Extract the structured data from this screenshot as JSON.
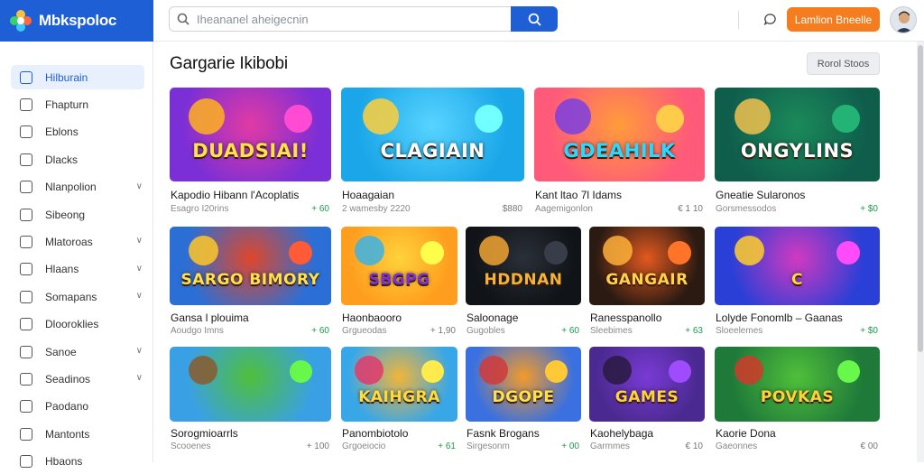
{
  "header": {
    "brand_name": "Mbkspoloc",
    "search_placeholder": "Iheananel aheigecnin",
    "cta_label": "Lamlion Bneelle"
  },
  "sidebar": {
    "items": [
      {
        "label": "Hilburain",
        "active": true,
        "chevron": false
      },
      {
        "label": "Fhapturn",
        "active": false,
        "chevron": false
      },
      {
        "label": "Eblons",
        "active": false,
        "chevron": false
      },
      {
        "label": "Dlacks",
        "active": false,
        "chevron": false
      },
      {
        "label": "Nlanpolion",
        "active": false,
        "chevron": true
      },
      {
        "label": "Sibeong",
        "active": false,
        "chevron": false
      },
      {
        "label": "Mlatoroas",
        "active": false,
        "chevron": true
      },
      {
        "label": "Hlaans",
        "active": false,
        "chevron": true
      },
      {
        "label": "Somapans",
        "active": false,
        "chevron": true
      },
      {
        "label": "Dlooroklies",
        "active": false,
        "chevron": false
      },
      {
        "label": "Sanoe",
        "active": false,
        "chevron": true
      },
      {
        "label": "Seadinos",
        "active": false,
        "chevron": true
      },
      {
        "label": "Paodano",
        "active": false,
        "chevron": false
      },
      {
        "label": "Mantonts",
        "active": false,
        "chevron": false
      },
      {
        "label": "Hbaons",
        "active": false,
        "chevron": false
      }
    ]
  },
  "main": {
    "title": "Gargarie Ikibobi",
    "sort_label": "Rorol Stoos"
  },
  "games": [
    {
      "title": "Kapodio Hibann l'Acoplatis",
      "sub": "Esagro I20rins",
      "price": "+ 60",
      "green": true,
      "art": "DUADSIAI!",
      "badge": "",
      "colors": [
        "#7b2fd6",
        "#e23aa3",
        "#ffb21e"
      ],
      "word_color": "#ffe14a"
    },
    {
      "title": "Hoaagaian",
      "sub": "2 wamesby 2220",
      "price": "$880",
      "green": false,
      "art": "CLAGIAIN",
      "badge": "",
      "colors": [
        "#1aa6e8",
        "#58d4ff",
        "#ffcf3a"
      ],
      "word_color": "#ffffff"
    },
    {
      "title": "Kant ltao 7l Idams",
      "sub": "Aagemigonlon",
      "price": "€ 1 10",
      "green": false,
      "art": "GDEAHILK",
      "badge": "",
      "colors": [
        "#ff5a7a",
        "#ff9c3a",
        "#7b3fe0"
      ],
      "word_color": "#2ad9ff"
    },
    {
      "title": "Gneatie Sularonos",
      "sub": "Gorsmessodos",
      "price": "+ $0",
      "green": true,
      "art": "ONGYLINS",
      "badge": "",
      "colors": [
        "#0f5e4c",
        "#1b8a5a",
        "#f2c14e"
      ],
      "word_color": "#ffffff"
    },
    {
      "title": "Gansa l plouima",
      "sub": "Aoudgo Imns",
      "price": "+ 60",
      "green": true,
      "art": "SARGO BIMORY",
      "badge": "",
      "colors": [
        "#2b6fd6",
        "#e0462a",
        "#ffc728"
      ],
      "word_color": "#ffe14a"
    },
    {
      "title": "Haonbaooro",
      "sub": "Grgueodas",
      "price": "+ 1,90",
      "green": false,
      "art": "SBGPG",
      "badge": "",
      "colors": [
        "#ff9d1e",
        "#ffd23a",
        "#3bb3e6"
      ],
      "word_color": "#7a2fd6"
    },
    {
      "title": "Saloonage",
      "sub": "Gugobles",
      "price": "+ 60",
      "green": true,
      "art": "HDDNAN",
      "badge": "",
      "colors": [
        "#101317",
        "#2a3038",
        "#f2a531"
      ],
      "word_color": "#f7b133"
    },
    {
      "title": "Ranesspanollo",
      "sub": "Sleebimes",
      "price": "+ 63",
      "green": true,
      "art": "GANGAIR",
      "badge": "",
      "colors": [
        "#2a1a12",
        "#e2591f",
        "#ffb03a"
      ],
      "word_color": "#ffd24a"
    },
    {
      "title": "Lolyde Fonomlb – Gaanas",
      "sub": "Sloeelemes",
      "price": "+ $0",
      "green": true,
      "art": "C",
      "badge": "",
      "colors": [
        "#2a3fd6",
        "#d13ac0",
        "#ffcf2a"
      ],
      "word_color": "#ffdc3a"
    },
    {
      "title": "Sorogmioarrls",
      "sub": "Scooenes",
      "price": "+ 100",
      "green": false,
      "art": "",
      "badge": "",
      "colors": [
        "#3aa0e6",
        "#4fbf3a",
        "#8a5a2a"
      ],
      "word_color": "#ffffff"
    },
    {
      "title": "Panombiotolo",
      "sub": "Grgoeiocio",
      "price": "+ 61",
      "green": true,
      "art": "KAIHGRA",
      "badge": "",
      "colors": [
        "#38a7e8",
        "#f2b53a",
        "#e23a6a"
      ],
      "word_color": "#ffdc3a"
    },
    {
      "title": "Fasnk Brogans",
      "sub": "Sirgesonm",
      "price": "+ 00",
      "green": true,
      "art": "DGOPE",
      "badge": "",
      "colors": [
        "#3a70e0",
        "#f29a2a",
        "#d13a3a"
      ],
      "word_color": "#ffe14a"
    },
    {
      "title": "Kaohelybaga",
      "sub": "Garmmes",
      "price": "€ 10",
      "green": false,
      "art": "GAMES",
      "badge": "",
      "colors": [
        "#4a2a90",
        "#7a3ad6",
        "#2a1a40"
      ],
      "word_color": "#ffd23a"
    },
    {
      "title": "Kaorie Dona",
      "sub": "Gaeonnes",
      "price": "€ 00",
      "green": false,
      "art": "POVKAS",
      "badge": "",
      "colors": [
        "#1f7a3a",
        "#4fbf3a",
        "#d13a2a"
      ],
      "word_color": "#ffd23a"
    }
  ]
}
